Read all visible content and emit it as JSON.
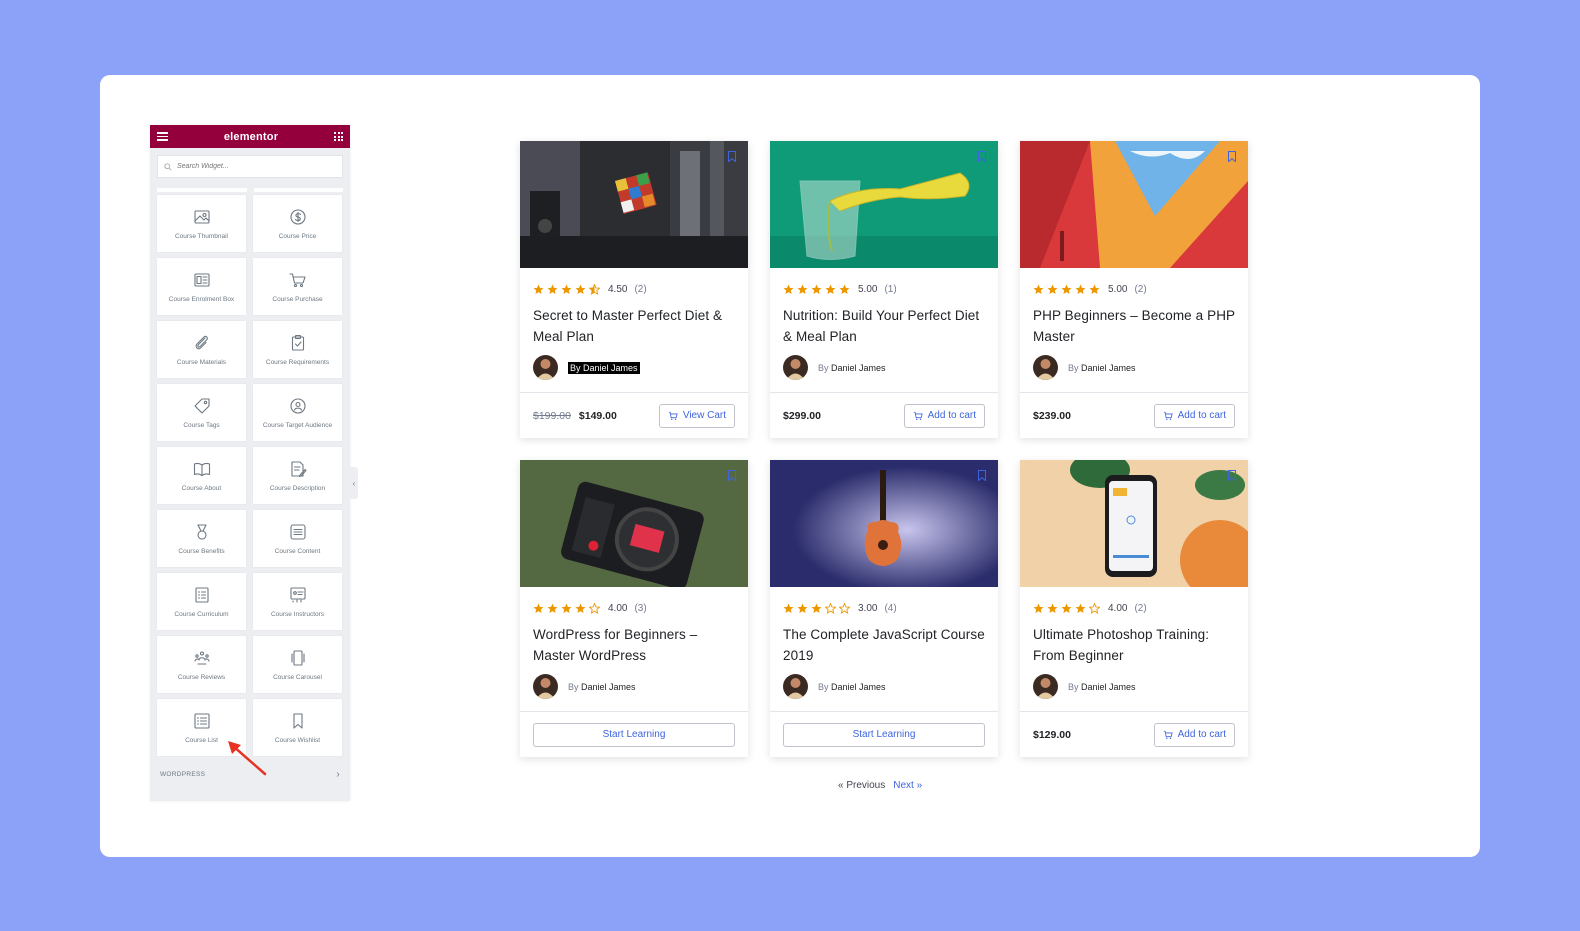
{
  "panel": {
    "brand": "elementor",
    "search_placeholder": "Search Widget...",
    "widgets": [
      {
        "label": "Course Thumbnail",
        "icon": "image-icon"
      },
      {
        "label": "Course Price",
        "icon": "dollar-icon"
      },
      {
        "label": "Course Enrolment Box",
        "icon": "enrolment-box-icon"
      },
      {
        "label": "Course Purchase",
        "icon": "cart-icon"
      },
      {
        "label": "Course Materials",
        "icon": "paperclip-icon"
      },
      {
        "label": "Course Requirements",
        "icon": "clipboard-check-icon"
      },
      {
        "label": "Course Tags",
        "icon": "tag-icon"
      },
      {
        "label": "Course Target Audience",
        "icon": "target-user-icon"
      },
      {
        "label": "Course About",
        "icon": "open-book-icon"
      },
      {
        "label": "Course Description",
        "icon": "description-icon"
      },
      {
        "label": "Course Benefits",
        "icon": "medal-icon"
      },
      {
        "label": "Course Content",
        "icon": "content-icon"
      },
      {
        "label": "Course Curriculum",
        "icon": "curriculum-icon"
      },
      {
        "label": "Course Instructors",
        "icon": "instructors-icon"
      },
      {
        "label": "Course Reviews",
        "icon": "reviews-icon"
      },
      {
        "label": "Course Carousel",
        "icon": "carousel-icon"
      },
      {
        "label": "Course List",
        "icon": "list-icon"
      },
      {
        "label": "Course Wishlist",
        "icon": "bookmark-icon"
      }
    ],
    "section_label": "WORDPRESS",
    "section_chevron": "›",
    "collapse_glyph": "‹"
  },
  "courses": [
    {
      "rating": "4.50",
      "count": "(2)",
      "stars": 4.5,
      "title": "Secret to Master Perfect Diet & Meal Plan",
      "by": "By",
      "author": "Daniel James",
      "old_price": "$199.00",
      "price": "$149.00",
      "action": "View Cart",
      "action_type": "cart",
      "highlight": true
    },
    {
      "rating": "5.00",
      "count": "(1)",
      "stars": 5,
      "title": "Nutrition: Build Your Perfect Diet & Meal Plan",
      "by": "By",
      "author": "Daniel James",
      "old_price": "",
      "price": "$299.00",
      "action": "Add to cart",
      "action_type": "cart",
      "highlight": false
    },
    {
      "rating": "5.00",
      "count": "(2)",
      "stars": 5,
      "title": "PHP Beginners – Become a PHP Master",
      "by": "By",
      "author": "Daniel James",
      "old_price": "",
      "price": "$239.00",
      "action": "Add to cart",
      "action_type": "cart",
      "highlight": false
    },
    {
      "rating": "4.00",
      "count": "(3)",
      "stars": 4,
      "title": "WordPress for Beginners – Master WordPress",
      "by": "By",
      "author": "Daniel James",
      "old_price": "",
      "price": "",
      "action": "Start Learning",
      "action_type": "learn",
      "highlight": false
    },
    {
      "rating": "3.00",
      "count": "(4)",
      "stars": 3,
      "title": "The Complete JavaScript Course 2019",
      "by": "By",
      "author": "Daniel James",
      "old_price": "",
      "price": "",
      "action": "Start Learning",
      "action_type": "learn",
      "highlight": false
    },
    {
      "rating": "4.00",
      "count": "(2)",
      "stars": 4,
      "title": "Ultimate Photoshop Training: From Beginner",
      "by": "By",
      "author": "Daniel James",
      "old_price": "",
      "price": "$129.00",
      "action": "Add to cart",
      "action_type": "cart",
      "highlight": false
    }
  ],
  "pagination": {
    "prev": "« Previous",
    "next": "Next »"
  },
  "colors": {
    "page_bg": "#8ca2f9",
    "brand": "#93003c",
    "accent": "#3e64de",
    "star": "#ed9700"
  }
}
